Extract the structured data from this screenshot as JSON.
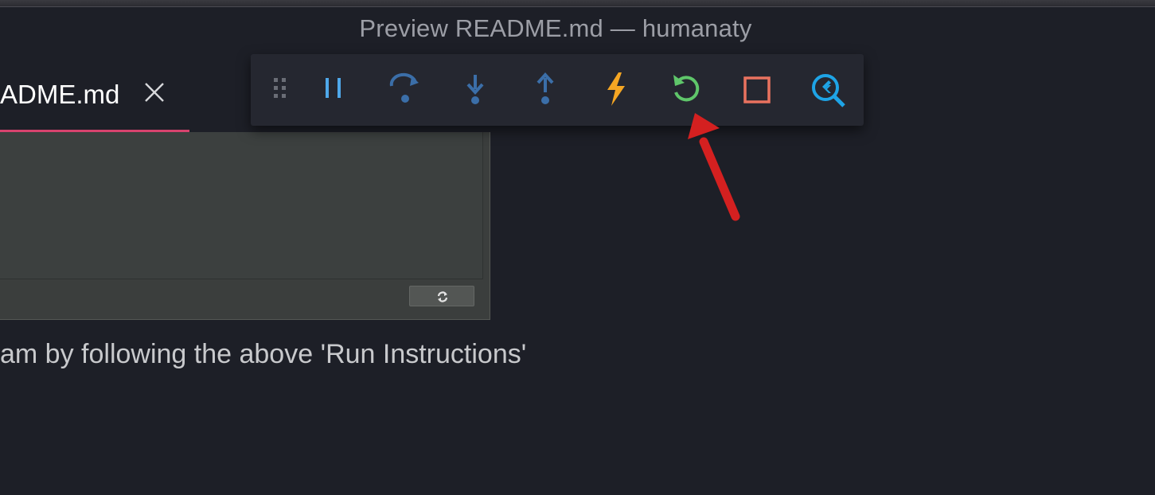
{
  "window": {
    "title": "Preview README.md — humanaty"
  },
  "editor": {
    "tab": {
      "label": "ADME.md",
      "close_icon": "close-icon"
    },
    "body_text": "am by following the above 'Run Instructions'"
  },
  "debug_toolbar": {
    "items": [
      {
        "name": "drag-handle",
        "icon": "grip-icon",
        "color": "#6a6d76"
      },
      {
        "name": "pause",
        "icon": "pause-icon",
        "color": "#4fa8ea"
      },
      {
        "name": "step-over",
        "icon": "step-over-icon",
        "color": "#3b6ea8"
      },
      {
        "name": "step-into",
        "icon": "step-into-icon",
        "color": "#3b6ea8"
      },
      {
        "name": "step-out",
        "icon": "step-out-icon",
        "color": "#3b6ea8"
      },
      {
        "name": "hot-reload",
        "icon": "lightning-icon",
        "color": "#f5a623"
      },
      {
        "name": "hot-restart",
        "icon": "restart-icon",
        "color": "#5fc66a"
      },
      {
        "name": "stop",
        "icon": "stop-icon",
        "color": "#e9725f"
      },
      {
        "name": "flutter-inspector",
        "icon": "flutter-inspector-icon",
        "color": "#1ea4e6"
      }
    ]
  },
  "annotation": {
    "arrow_color": "#d42020"
  }
}
